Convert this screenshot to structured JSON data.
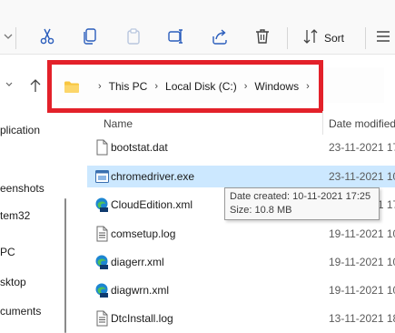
{
  "toolbar": {
    "buttons": [
      {
        "icon": "chevron-down-icon"
      },
      {
        "icon": "cut-icon"
      },
      {
        "icon": "copy-icon"
      },
      {
        "icon": "paste-icon"
      },
      {
        "icon": "rename-icon"
      },
      {
        "icon": "share-icon"
      },
      {
        "icon": "delete-icon"
      },
      {
        "icon": "sort-icon"
      },
      {
        "icon": "view-icon"
      }
    ],
    "sort_label": "Sort"
  },
  "address_bar": {
    "folder_icon": "folder-icon",
    "crumbs": [
      "This PC",
      "Local Disk (C:)",
      "Windows"
    ],
    "highlight_color": "#e3212a"
  },
  "nav_pane": {
    "items": [
      "plication",
      "eenshots",
      "tem32",
      "PC",
      "sktop",
      "cuments"
    ]
  },
  "file_list": {
    "headers": {
      "name": "Name",
      "date": "Date modified"
    },
    "rows": [
      {
        "name": "bootstat.dat",
        "date": "23-11-2021 17",
        "icon": "file-icon",
        "selected": false
      },
      {
        "name": "chromedriver.exe",
        "date": "23-11-2021 10",
        "icon": "exe-icon",
        "selected": true
      },
      {
        "name": "CloudEdition.xml",
        "date": "10-11-2021 17",
        "icon": "xml-edge-icon",
        "selected": false
      },
      {
        "name": "comsetup.log",
        "date": "19-11-2021 10",
        "icon": "log-file-icon",
        "selected": false
      },
      {
        "name": "diagerr.xml",
        "date": "19-11-2021 10",
        "icon": "xml-edge-icon",
        "selected": false
      },
      {
        "name": "diagwrn.xml",
        "date": "19-11-2021 10",
        "icon": "xml-edge-icon",
        "selected": false
      },
      {
        "name": "DtcInstall.log",
        "date": "13-11-2021 18",
        "icon": "log-file-icon",
        "selected": false
      }
    ]
  },
  "tooltip": {
    "date_created": "Date created: 10-11-2021 17:25",
    "size": "Size: 10.8 MB"
  },
  "colors": {
    "accent_blue": "#0067c0",
    "selection": "#cce8ff",
    "folder_yellow": "#f8c640"
  }
}
